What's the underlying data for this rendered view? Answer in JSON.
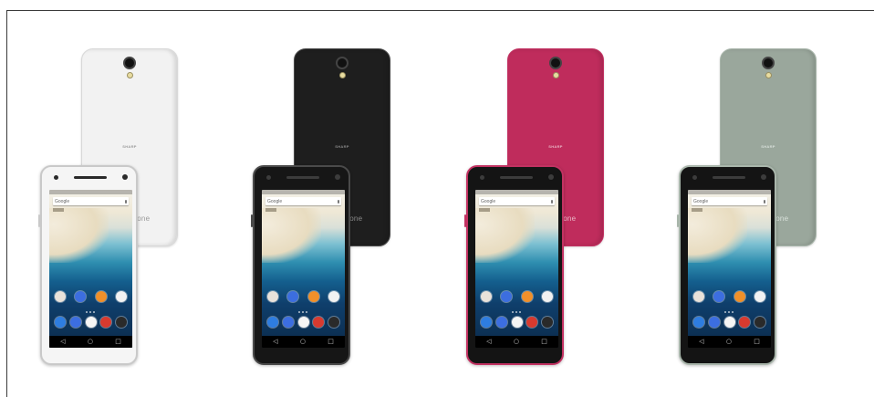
{
  "scene": {
    "background": "#ffffff",
    "frame_line_color": "#3a3a3a"
  },
  "variants": [
    {
      "color_name": "white",
      "body_color": "#f2f2f2",
      "front_bezel_color": "#f5f5f5",
      "front_border_color": "#c9c9c9",
      "front_detail_color": "#2a2a2a",
      "back_label_color": "#9a9a9a"
    },
    {
      "color_name": "black",
      "body_color": "#1e1e1e",
      "front_bezel_color": "#161616",
      "front_border_color": "#4a4a4a",
      "front_detail_color": "#3c3c3c",
      "back_label_color": "#8a8a8a"
    },
    {
      "color_name": "pink",
      "body_color": "#bf2c5c",
      "front_bezel_color": "#141414",
      "front_border_color": "#c23262",
      "front_detail_color": "#3c3c3c",
      "back_label_color": "#e9b7c6"
    },
    {
      "color_name": "green",
      "body_color": "#9aa79c",
      "front_bezel_color": "#141414",
      "front_border_color": "#a9b6ab",
      "front_detail_color": "#3c3c3c",
      "back_label_color": "#d8e0da"
    }
  ],
  "phone_labels": {
    "brand": "SHARP",
    "os": "android one",
    "search_label": "Google"
  },
  "app_icons": {
    "apps": [
      {
        "name": "camera-app-icon",
        "color": "#e9e2da"
      },
      {
        "name": "messages-app-icon",
        "color": "#3c6ee0"
      },
      {
        "name": "photos-app-icon",
        "color": "#f0902a"
      },
      {
        "name": "play-store-icon",
        "color": "#f2f2f2"
      }
    ],
    "dock": [
      {
        "name": "phone-app-icon",
        "color": "#2e7de0"
      },
      {
        "name": "sms-app-icon",
        "color": "#3c6ee0"
      },
      {
        "name": "app-drawer-icon",
        "color": "#f5f5f5"
      },
      {
        "name": "chrome-app-icon",
        "color": "#d83a2f"
      },
      {
        "name": "camera-shortcut-icon",
        "color": "#2a2a2a"
      }
    ]
  },
  "nav_icons": {
    "back": "◁",
    "home": "○",
    "recents": "□"
  }
}
